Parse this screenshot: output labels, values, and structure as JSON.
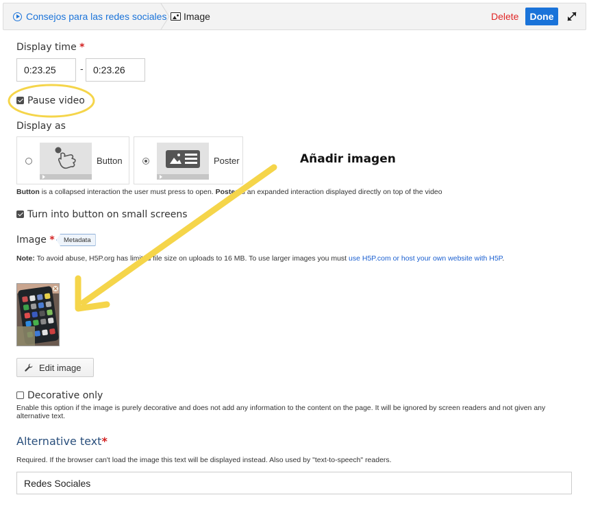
{
  "topbar": {
    "breadcrumb_parent": "Consejos para las redes sociales",
    "breadcrumb_current": "Image",
    "delete_label": "Delete",
    "done_label": "Done"
  },
  "display_time": {
    "label": "Display time",
    "required_mark": "*",
    "start_value": "0:23.25",
    "separator": "-",
    "end_value": "0:23.26"
  },
  "pause_video": {
    "label": "Pause video",
    "checked": true
  },
  "display_as": {
    "label": "Display as",
    "options": [
      {
        "label": "Button",
        "selected": false
      },
      {
        "label": "Poster",
        "selected": true
      }
    ],
    "help_button_term": "Button",
    "help_part1": " is a collapsed interaction the user must press to open. ",
    "help_poster_term": "Poster",
    "help_part2": " is an expanded interaction displayed directly on top of the video"
  },
  "turn_into_button": {
    "label": "Turn into button on small screens",
    "checked": true
  },
  "image_field": {
    "label": "Image",
    "required_mark": "*",
    "metadata_label": "Metadata",
    "note_prefix": "Note:",
    "note_text": " To avoid abuse, H5P.org has limited file size on uploads to 16 MB. To use larger images you must ",
    "note_link": "use H5P.com or host your own website with H5P",
    "note_suffix": ".",
    "edit_image_label": "Edit image"
  },
  "decorative_only": {
    "label": "Decorative only",
    "checked": false,
    "description": "Enable this option if the image is purely decorative and does not add any information to the content on the page. It will be ignored by screen readers and not given any alternative text."
  },
  "alternative_text": {
    "label": "Alternative text",
    "required_mark": "*",
    "description": "Required. If the browser can't load the image this text will be displayed instead. Also used by \"text-to-speech\" readers.",
    "value": "Redes Sociales"
  },
  "annotation": {
    "text": "Añadir imagen"
  },
  "colors": {
    "accent_blue": "#1a73d9",
    "delete_red": "#e02626",
    "highlight_yellow": "#f5d54a"
  }
}
